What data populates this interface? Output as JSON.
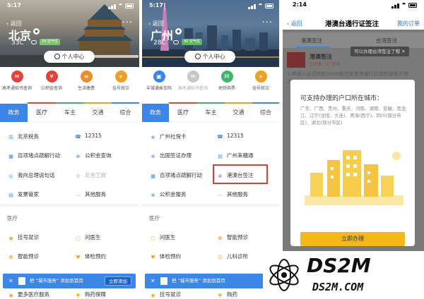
{
  "panel1": {
    "status_time": "5:17",
    "back_label": "返回",
    "menu_glyph": "···",
    "city": "北京",
    "temperature": "33C",
    "aqi_badge": "34 空气优",
    "personal_center": "个人中心",
    "quick_items": [
      {
        "label": "高考通知书查询",
        "icon": "mail-icon",
        "color": "#e0453a",
        "glyph": "✉",
        "dim": false
      },
      {
        "label": "公积金查询",
        "icon": "fund-icon",
        "color": "#e0453a",
        "glyph": "¥",
        "dim": false
      },
      {
        "label": "生活缴费",
        "icon": "payment-icon",
        "color": "#f08b2a",
        "glyph": "≡",
        "dim": false
      },
      {
        "label": "挂号就诊",
        "icon": "hospital-icon",
        "color": "#f0a020",
        "glyph": "+",
        "dim": false
      }
    ],
    "tabs": [
      "政务",
      "医疗",
      "车主",
      "交通",
      "综合"
    ],
    "active_tab": 0,
    "grid_items": [
      {
        "label": "北京税务",
        "icon": "tax-icon",
        "glyph": "☰",
        "dim": false
      },
      {
        "label": "12315",
        "icon": "complaint-icon",
        "glyph": "☎",
        "dim": false
      },
      {
        "label": "百项堵点疏解行动",
        "icon": "building-icon",
        "glyph": "▦",
        "dim": false
      },
      {
        "label": "公积金查询",
        "icon": "fund-search-icon",
        "glyph": "⊕",
        "dim": false
      },
      {
        "label": "我向总理说句话",
        "icon": "message-icon",
        "glyph": "◎",
        "dim": false
      },
      {
        "label": "北京工商",
        "icon": "commerce-icon",
        "glyph": "⚙",
        "dim": true
      },
      {
        "label": "发票管家",
        "icon": "invoice-icon",
        "glyph": "▤",
        "dim": false
      },
      {
        "label": "其他服务",
        "icon": "more-icon",
        "glyph": "···",
        "dim": false
      }
    ],
    "section_title": "医疗",
    "medical_items": [
      {
        "label": "挂号就诊",
        "icon": "register-icon",
        "glyph": "◉"
      },
      {
        "label": "问医生",
        "icon": "doctor-icon",
        "glyph": "▢"
      },
      {
        "label": "智能预诊",
        "icon": "diagnosis-icon",
        "glyph": "✿"
      },
      {
        "label": "体检预约",
        "icon": "checkup-icon",
        "glyph": "♥"
      },
      {
        "label": "更多医疗服务",
        "icon": "more-medical-icon",
        "glyph": "◉"
      },
      {
        "label": "购药保障",
        "icon": "medicine-icon",
        "glyph": "✚"
      }
    ],
    "banner_text": "把 “城市服务” 添加到首页",
    "banner_button": "立即添加"
  },
  "panel2": {
    "status_time": "5:17",
    "back_label": "返回",
    "menu_glyph": "···",
    "city": "广州",
    "temperature": "28C",
    "aqi_badge": "40 空气优",
    "personal_center": "个人中心",
    "quick_items": [
      {
        "label": "羊城通乘车码",
        "icon": "transit-card-icon",
        "color": "#3b86e6",
        "glyph": "▣",
        "dim": false
      },
      {
        "label": "高考通知书查询",
        "icon": "mail-icon",
        "color": "#c8c8c8",
        "glyph": "✉",
        "dim": true
      },
      {
        "label": "地铁购票",
        "icon": "metro-icon",
        "color": "#3fb56b",
        "glyph": "M",
        "dim": false
      },
      {
        "label": "挂号就诊",
        "icon": "hospital-icon",
        "color": "#f0a020",
        "glyph": "+",
        "dim": false
      }
    ],
    "tabs": [
      "政务",
      "医疗",
      "车主",
      "交通",
      "综合"
    ],
    "active_tab": 0,
    "grid_items": [
      {
        "label": "广州社保卡",
        "icon": "social-security-icon",
        "glyph": "⊕",
        "dim": false
      },
      {
        "label": "12315",
        "icon": "complaint-icon",
        "glyph": "☎",
        "dim": false
      },
      {
        "label": "出国签证办理",
        "icon": "visa-icon",
        "glyph": "⊕",
        "dim": false
      },
      {
        "label": "广州来穗通",
        "icon": "resident-icon",
        "glyph": "▤",
        "dim": false
      },
      {
        "label": "百项堵点疏解行动",
        "icon": "building-icon",
        "glyph": "▦",
        "dim": false
      },
      {
        "label": "港澳台签注",
        "icon": "globe-icon",
        "glyph": "⊕",
        "dim": false
      },
      {
        "label": "公积金服务",
        "icon": "fund-icon",
        "glyph": "⊕",
        "dim": false
      },
      {
        "label": "其他服务",
        "icon": "more-icon",
        "glyph": "···",
        "dim": false
      }
    ],
    "section_title": "医疗",
    "medical_items": [
      {
        "label": "问医生",
        "icon": "doctor-icon",
        "glyph": "▢"
      },
      {
        "label": "智能预诊",
        "icon": "diagnosis-icon",
        "glyph": "✿"
      },
      {
        "label": "体检预约",
        "icon": "checkup-icon",
        "glyph": "♥"
      },
      {
        "label": "儿科诊所",
        "icon": "pediatric-icon",
        "glyph": "☺"
      },
      {
        "label": "挂号就诊",
        "icon": "register-icon",
        "glyph": "◉"
      },
      {
        "label": "购药",
        "icon": "medicine-icon",
        "glyph": "✚"
      }
    ],
    "banner_text": "把 “城市服务” 添加到首页",
    "banner_button": "立"
  },
  "panel3": {
    "status_time": "2:14",
    "back_label": "返回",
    "title": "港澳台通行证签注",
    "my_orders": "我的订单",
    "tabs": [
      "港澳签注",
      "台湾签注"
    ],
    "tooltip": "可以办理台湾签注了哦",
    "bg_header": "港澳签注",
    "bg_badge": "已开通 · 上门取件",
    "bg_lines": [
      "1.申请人必须持有2000版往来港澳通行证或新版电子港",
      "2.G"
    ],
    "modal_question": "可支持办理的户口所在城市：",
    "modal_cities": "广东、广西、贵州、重庆、河南、湖南、安徽、黑龙江、辽宁(沈阳、大连)、青海(西宁)、四川(部分市区)、湖北(部分市区)",
    "modal_button": "立即办理"
  },
  "watermark": {
    "brand": "DS2M",
    "site": "DS2M.COM"
  },
  "colors": {
    "primary": "#3b86e6",
    "highlight": "#e53935",
    "cta": "#f5b81a",
    "aqi": "#7cc36b"
  }
}
